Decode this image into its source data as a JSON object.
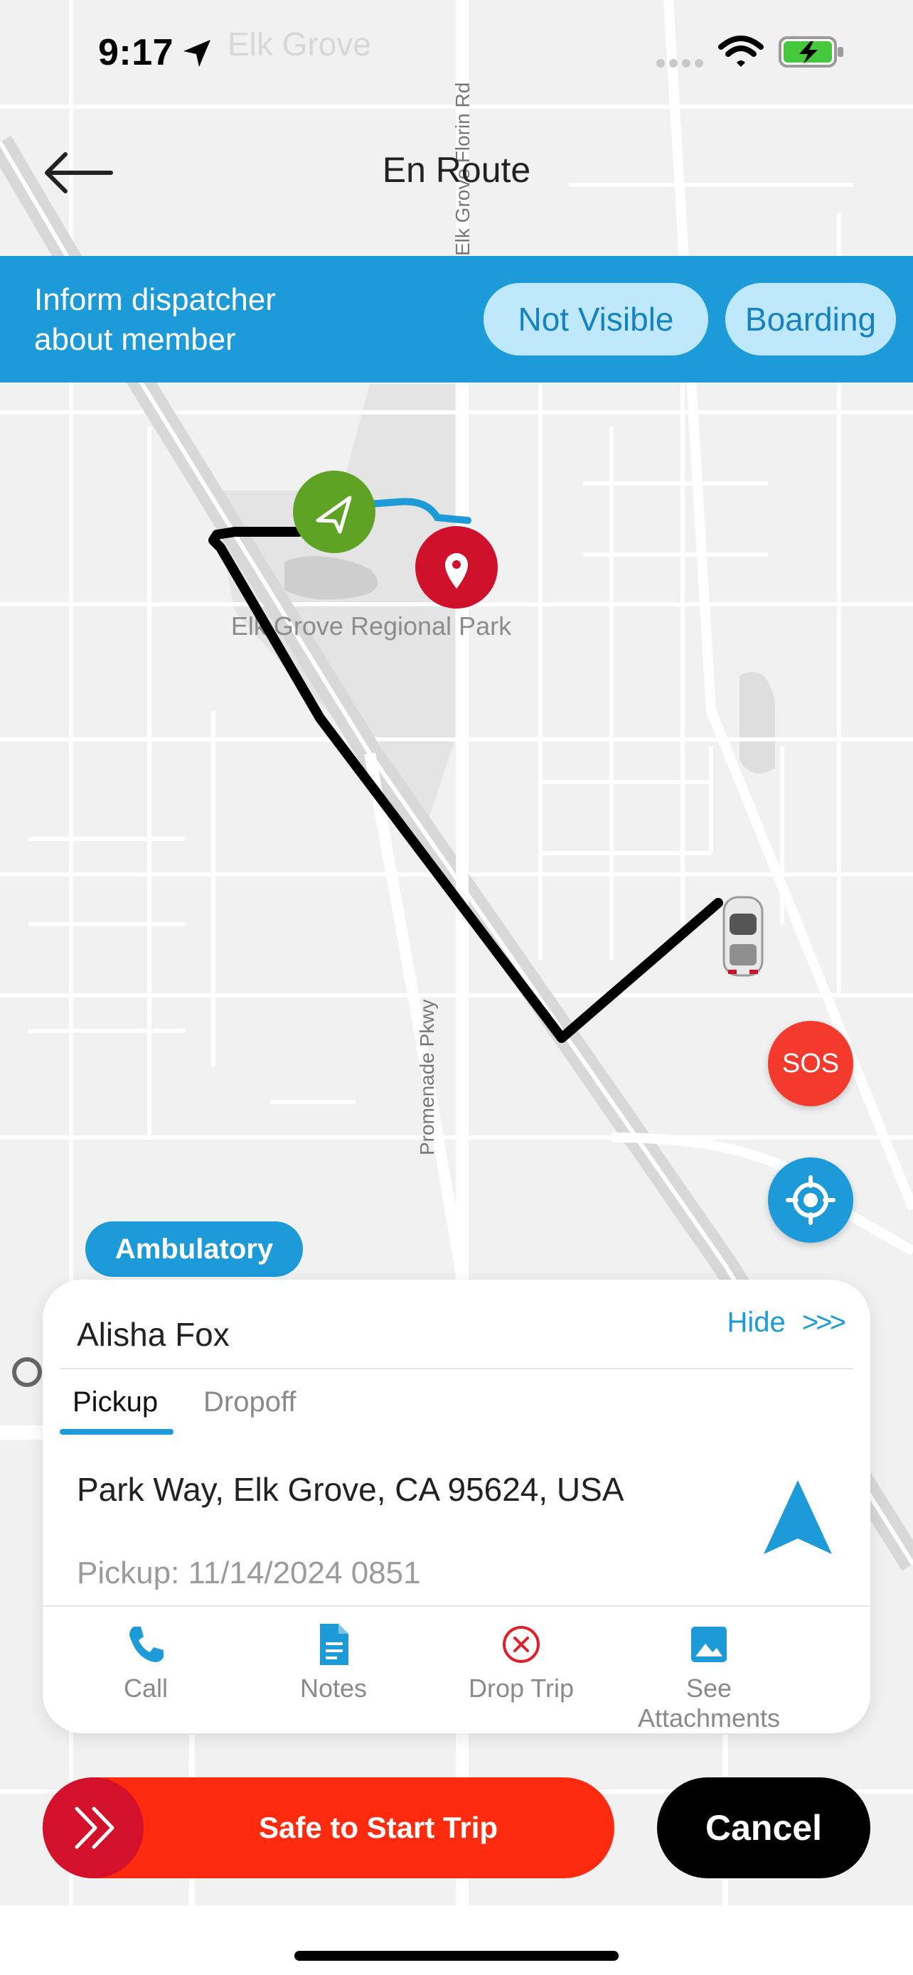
{
  "status_bar": {
    "time": "9:17"
  },
  "header": {
    "title": "En Route"
  },
  "banner": {
    "line1": "Inform dispatcher",
    "line2": "about member",
    "btn_not_visible": "Not Visible",
    "btn_boarding": "Boarding"
  },
  "map": {
    "park_label": "Elk Grove Regional Park",
    "road_promenade": "Promenade Pkwy",
    "road_top": "Elk Grove Florin Rd",
    "faint_city": "Elk Grove"
  },
  "sos_label": "SOS",
  "mobility_badge": "Ambulatory",
  "card": {
    "passenger_name": "Alisha Fox",
    "hide_label": "Hide",
    "hide_chevrons": ">>>",
    "tabs": [
      "Pickup",
      "Dropoff"
    ],
    "address": "Park Way, Elk Grove, CA 95624, USA",
    "pickup_time": "Pickup: 11/14/2024 0851",
    "actions": [
      {
        "label": "Call",
        "icon": "phone-icon"
      },
      {
        "label": "Notes",
        "icon": "document-icon"
      },
      {
        "label": "Drop Trip",
        "icon": "x-circle-icon"
      },
      {
        "label": "See Attachments",
        "icon": "image-icon"
      }
    ]
  },
  "slide_button": "Safe to Start Trip",
  "cancel_button": "Cancel",
  "colors": {
    "accent": "#1d9bd8",
    "banner_pill": "#bfe9fb",
    "sos": "#f33a2c",
    "slide": "#ff2b0f",
    "pickup_green": "#5ea323",
    "marker_red": "#d0112b"
  }
}
